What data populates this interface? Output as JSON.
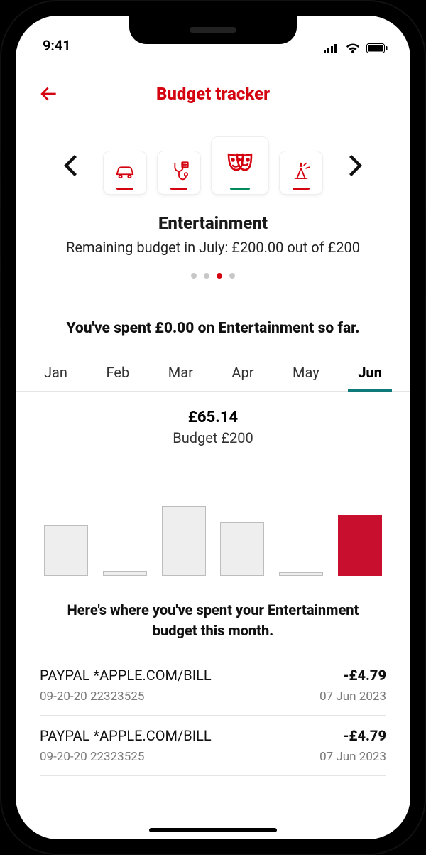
{
  "status": {
    "time": "9:41"
  },
  "header": {
    "title": "Budget tracker"
  },
  "categories": {
    "items": [
      {
        "name": "transport-icon"
      },
      {
        "name": "health-icon"
      },
      {
        "name": "entertainment-icon"
      },
      {
        "name": "celebration-icon"
      }
    ],
    "active_index": 2,
    "title": "Entertainment",
    "subtitle": "Remaining budget in July: £200.00 out of £200",
    "dots_total": 4,
    "dots_active": 2
  },
  "spend_summary": "You've spent £0.00 on Entertainment so far.",
  "months": {
    "items": [
      "Jan",
      "Feb",
      "Mar",
      "Apr",
      "May",
      "Jun"
    ],
    "active_index": 5
  },
  "chart_data": {
    "type": "bar",
    "categories": [
      "Jan",
      "Feb",
      "Mar",
      "Apr",
      "May",
      "Jun"
    ],
    "values": [
      95,
      8,
      130,
      100,
      6,
      115
    ],
    "title": "£65.14",
    "subtitle": "Budget £200",
    "xlabel": "",
    "ylabel": "",
    "ylim": [
      0,
      200
    ],
    "highlight_index": 5
  },
  "transactions": {
    "heading": "Here's where you've spent your Entertainment budget this month.",
    "items": [
      {
        "merchant": "PAYPAL *APPLE.COM/BILL",
        "amount": "-£4.79",
        "meta_left": "09-20-20  22323525",
        "meta_right": "07 Jun 2023"
      },
      {
        "merchant": "PAYPAL *APPLE.COM/BILL",
        "amount": "-£4.79",
        "meta_left": "09-20-20  22323525",
        "meta_right": "07 Jun 2023"
      }
    ]
  }
}
